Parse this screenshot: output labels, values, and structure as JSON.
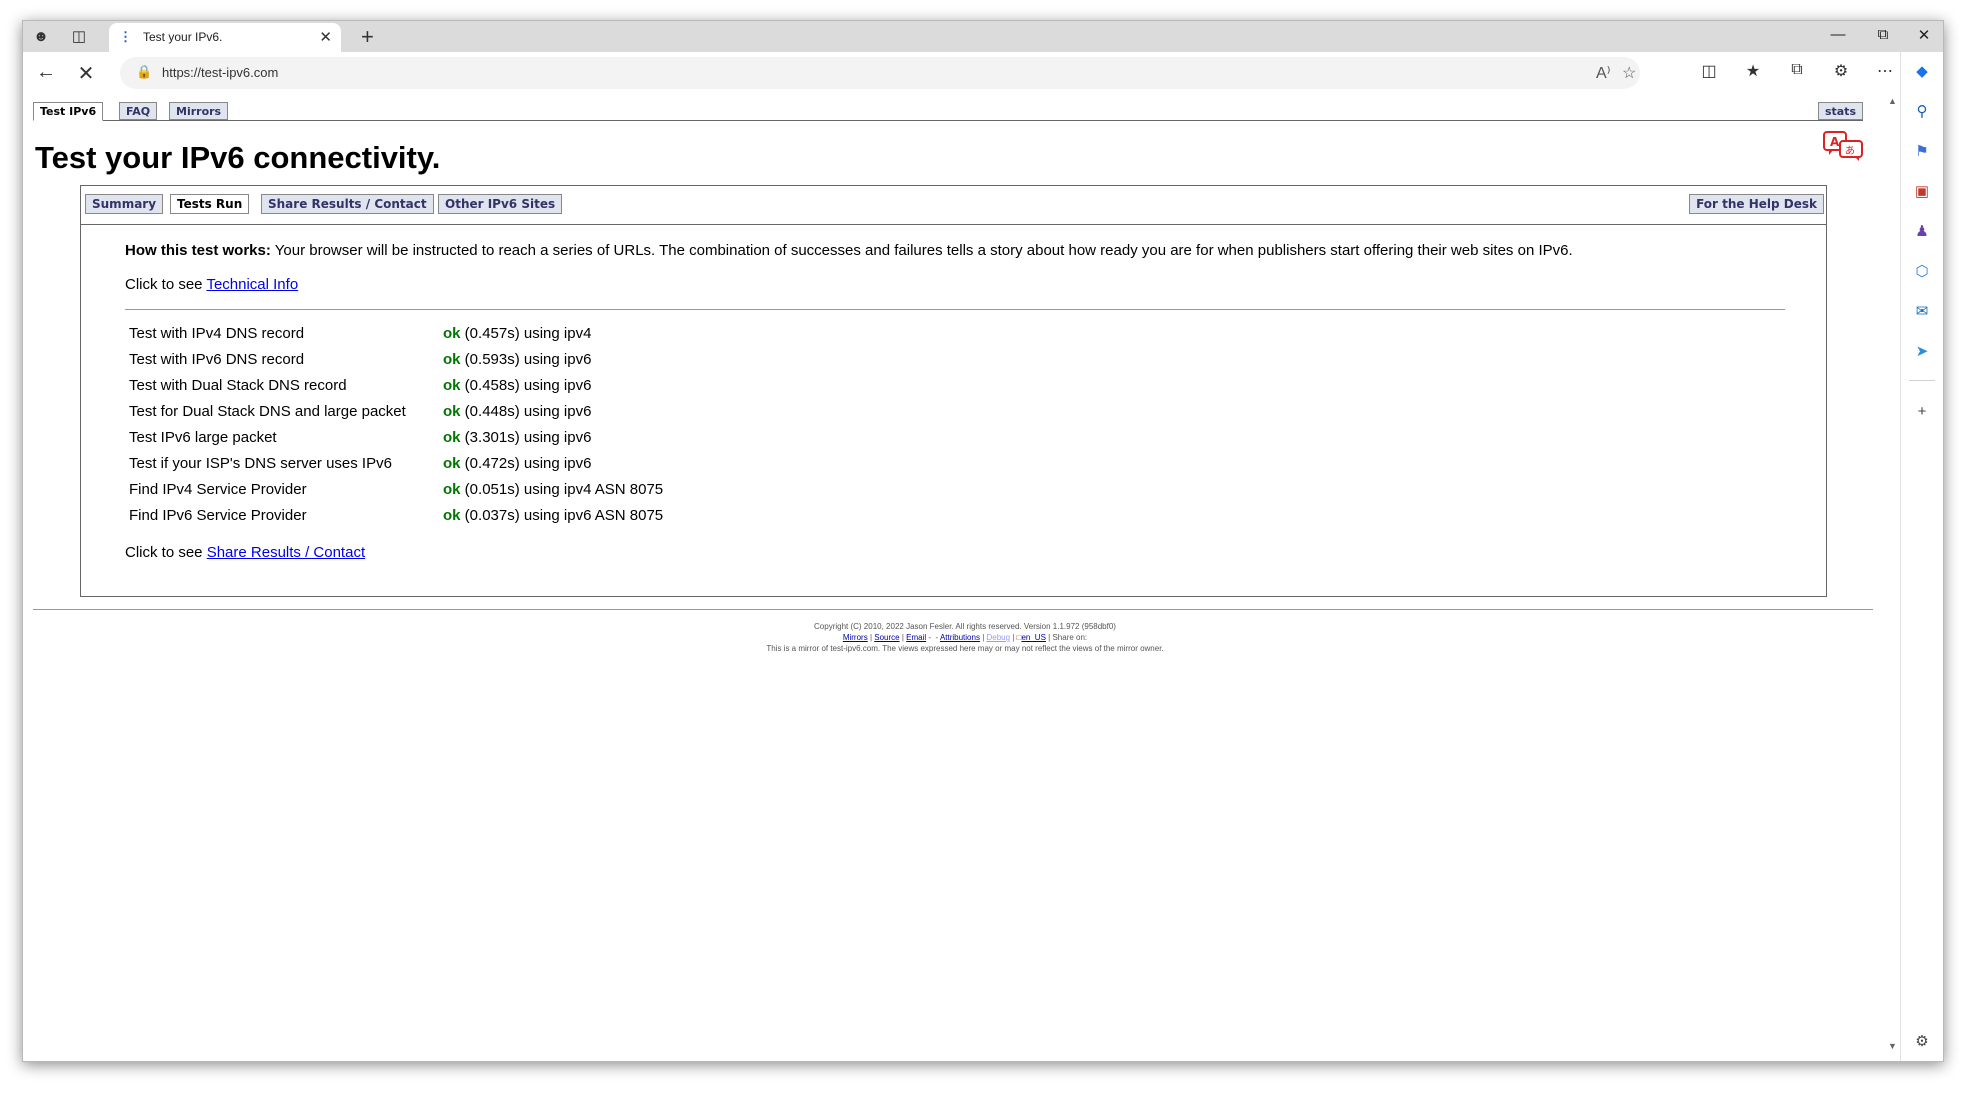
{
  "browser": {
    "tab_title": "Test your IPv6.",
    "url": "https://test-ipv6.com",
    "new_tab": "+",
    "window_controls": [
      "minimize-icon",
      "restore-icon",
      "close-icon"
    ]
  },
  "page_tabs": {
    "left": [
      "Test IPv6",
      "FAQ",
      "Mirrors"
    ],
    "right": "stats"
  },
  "heading": "Test your IPv6 connectivity.",
  "sub_tabs": {
    "items": [
      "Summary",
      "Tests Run",
      "Share Results / Contact",
      "Other IPv6 Sites"
    ],
    "right": "For the Help Desk"
  },
  "how_it_works": {
    "label": "How this test works:",
    "text": " Your browser will be instructed to reach a series of URLs. The combination of successes and failures tells a story about how ready you are for when publishers start offering their web sites on IPv6."
  },
  "links": {
    "prefix": "Click to see ",
    "technical_info": "Technical Info",
    "share_results": "Share Results / Contact"
  },
  "tests": [
    {
      "name": "Test with IPv4 DNS record",
      "status": "ok",
      "detail": " (0.457s) using ipv4"
    },
    {
      "name": "Test with IPv6 DNS record",
      "status": "ok",
      "detail": " (0.593s) using ipv6"
    },
    {
      "name": "Test with Dual Stack DNS record",
      "status": "ok",
      "detail": " (0.458s) using ipv6"
    },
    {
      "name": "Test for Dual Stack DNS and large packet",
      "status": "ok",
      "detail": " (0.448s) using ipv6"
    },
    {
      "name": "Test IPv6 large packet",
      "status": "ok",
      "detail": " (3.301s) using ipv6"
    },
    {
      "name": "Test if your ISP's DNS server uses IPv6",
      "status": "ok",
      "detail": " (0.472s) using ipv6"
    },
    {
      "name": "Find IPv4 Service Provider",
      "status": "ok",
      "detail": " (0.051s) using ipv4 ASN 8075"
    },
    {
      "name": "Find IPv6 Service Provider",
      "status": "ok",
      "detail": " (0.037s) using ipv6 ASN 8075"
    }
  ],
  "footer": {
    "copyright": "Copyright (C) 2010, 2022 Jason Fesler. All rights reserved. Version 1.1.972 (958dbf0)",
    "links": [
      "Mirrors",
      "Source",
      "Email",
      "Attributions",
      "Debug",
      "en_US"
    ],
    "share_on": "Share on:",
    "mirror_note": "This is a mirror of test-ipv6.com. The views expressed here may or may not reflect the views of the mirror owner."
  },
  "colors": {
    "ok": "#007700",
    "link": "#0000ee",
    "tab_bg": "#dfe4ee"
  }
}
